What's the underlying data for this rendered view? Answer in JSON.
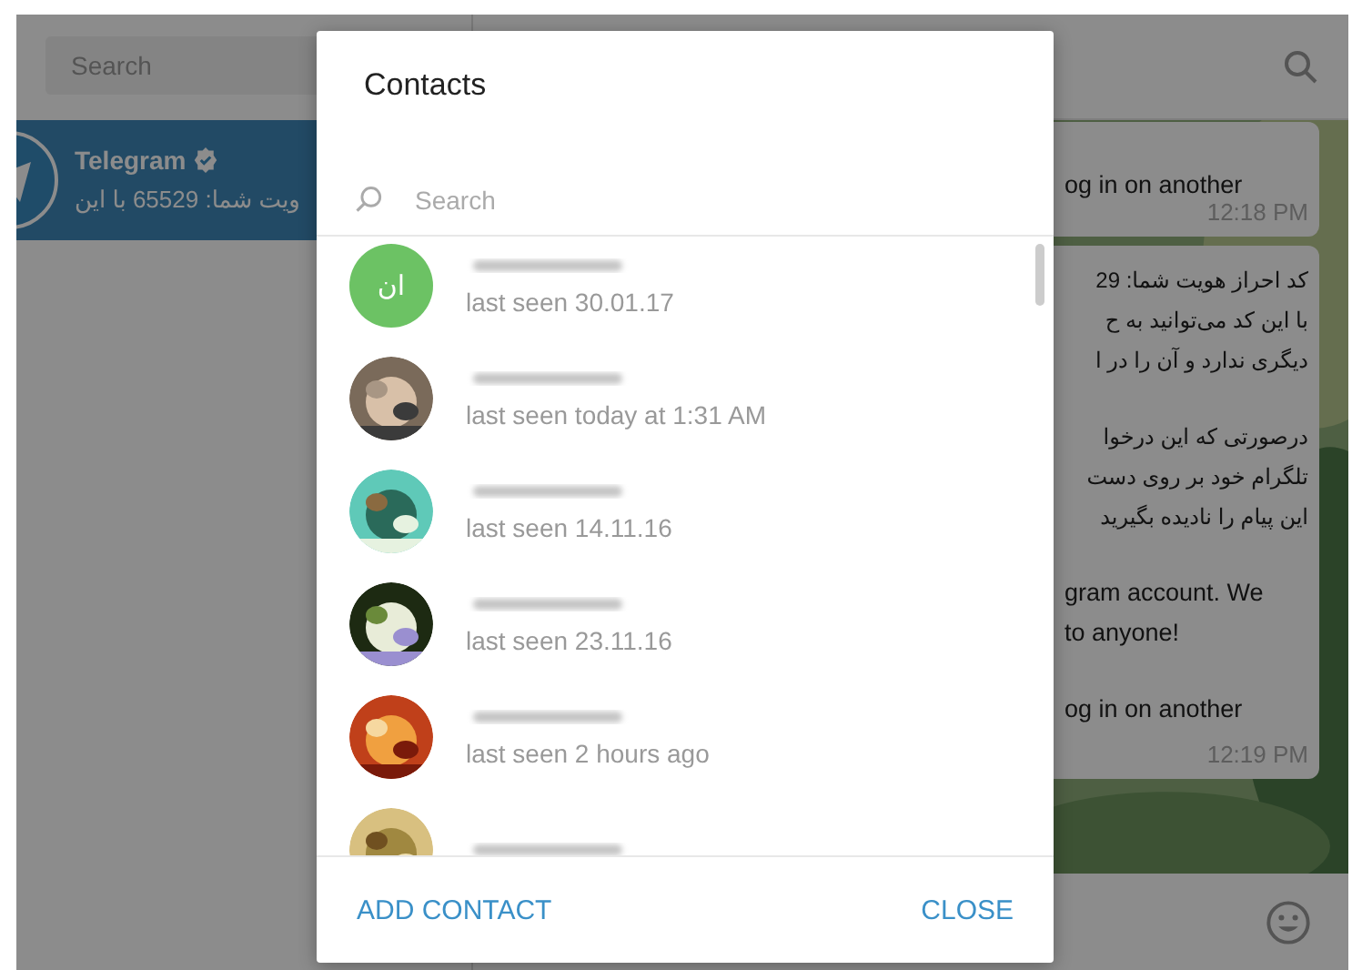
{
  "sidebar": {
    "search": {
      "placeholder": "Search"
    },
    "chats": [
      {
        "name": "Telegram",
        "verified": true,
        "preview": "ویت شما: 65529 با این",
        "selected": true
      }
    ]
  },
  "chat": {
    "messages": [
      {
        "paragraphs": [
          [
            {
              "text": "og in on another",
              "rtl": false
            }
          ]
        ],
        "time": "12:18 PM"
      },
      {
        "paragraphs": [
          [
            {
              "text": "کد احراز هویت شما: 29",
              "rtl": true
            },
            {
              "text": "با این کد می‌توانید به ح",
              "rtl": true
            },
            {
              "text": "دیگری ندارد و آن را در ا",
              "rtl": true
            }
          ],
          [
            {
              "text": "درصورتی که این درخوا",
              "rtl": true
            },
            {
              "text": "تلگرام خود بر روی دست",
              "rtl": true
            },
            {
              "text": "این پیام را نادیده بگیرید",
              "rtl": true
            }
          ],
          [
            {
              "text": "gram account. We",
              "rtl": false
            },
            {
              "text": "to anyone!",
              "rtl": false
            }
          ],
          [
            {
              "text": "og in on another",
              "rtl": false
            }
          ]
        ],
        "time": "12:19 PM"
      }
    ]
  },
  "dialog": {
    "title": "Contacts",
    "search": {
      "placeholder": "Search"
    },
    "contacts": [
      {
        "avatar": {
          "kind": "initials",
          "initials": "ان",
          "color": "#6cc264"
        },
        "status": "last seen 30.01.17"
      },
      {
        "avatar": {
          "kind": "picture"
        },
        "status": "last seen today at 1:31 AM"
      },
      {
        "avatar": {
          "kind": "picture"
        },
        "status": "last seen 14.11.16"
      },
      {
        "avatar": {
          "kind": "picture"
        },
        "status": "last seen 23.11.16"
      },
      {
        "avatar": {
          "kind": "picture"
        },
        "status": "last seen 2 hours ago"
      },
      {
        "avatar": {
          "kind": "picture"
        }
      }
    ],
    "buttons": [
      "ADD CONTACT",
      "CLOSE"
    ]
  }
}
